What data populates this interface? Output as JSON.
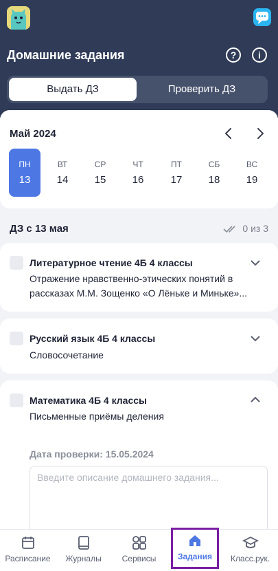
{
  "header": {
    "title": "Домашние задания",
    "help_icon": "question-circle-icon",
    "info_icon": "info-circle-icon",
    "segments": {
      "assign": "Выдать ДЗ",
      "check": "Проверить ДЗ",
      "selected": "assign"
    },
    "accent": "#2f3b57"
  },
  "calendar": {
    "month": "Май 2024",
    "days": [
      {
        "name": "ПН",
        "date": "13",
        "selected": true
      },
      {
        "name": "ВТ",
        "date": "14"
      },
      {
        "name": "СР",
        "date": "15"
      },
      {
        "name": "ЧТ",
        "date": "16"
      },
      {
        "name": "ПТ",
        "date": "17"
      },
      {
        "name": "СБ",
        "date": "18"
      },
      {
        "name": "ВС",
        "date": "19"
      }
    ],
    "selected_color": "#4d78e4"
  },
  "homework": {
    "section_title": "ДЗ с 13 мая",
    "counter": "0 из 3",
    "items": [
      {
        "title": "Литературное чтение 4Б 4 классы",
        "description": "Отражение нравственно-этических понятий в рассказах М.М. Зощенко «О Лёньке и Миньке»...",
        "expanded": false
      },
      {
        "title": "Русский язык 4Б 4 классы",
        "description": "Словосочетание",
        "expanded": false
      },
      {
        "title": "Математика 4Б 4 классы",
        "description": "Письменные приёмы деления",
        "expanded": true,
        "check_date": "Дата проверки: 15.05.2024",
        "input_placeholder": "Введите описание домашнего задания..."
      }
    ]
  },
  "tabbar": {
    "tabs": [
      {
        "label": "Расписание",
        "icon": "calendar-icon"
      },
      {
        "label": "Журналы",
        "icon": "book-icon"
      },
      {
        "label": "Сервисы",
        "icon": "grid-icon"
      },
      {
        "label": "Задания",
        "icon": "home-icon",
        "active": true
      },
      {
        "label": "Класс.рук.",
        "icon": "graduation-cap-icon"
      }
    ]
  }
}
